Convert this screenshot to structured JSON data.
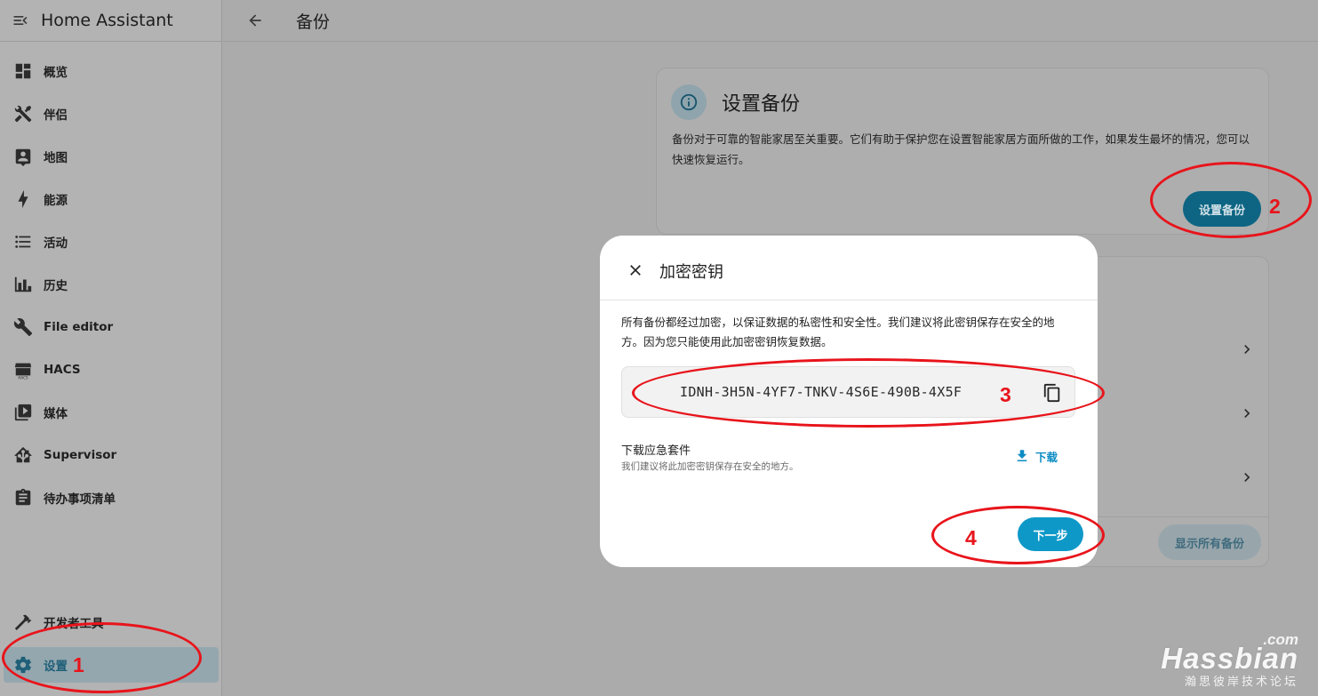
{
  "app": {
    "title": "Home Assistant"
  },
  "sidebar": {
    "items": [
      {
        "label": "概览",
        "icon": "dashboard-icon"
      },
      {
        "label": "伴侣",
        "icon": "tools-icon"
      },
      {
        "label": "地图",
        "icon": "map-account-icon"
      },
      {
        "label": "能源",
        "icon": "lightning-icon"
      },
      {
        "label": "活动",
        "icon": "list-icon"
      },
      {
        "label": "历史",
        "icon": "chart-box-icon"
      },
      {
        "label": "File editor",
        "icon": "wrench-icon"
      },
      {
        "label": "HACS",
        "icon": "hacs-icon"
      },
      {
        "label": "媒体",
        "icon": "play-box-icon"
      },
      {
        "label": "Supervisor",
        "icon": "home-assistant-icon"
      },
      {
        "label": "待办事项清单",
        "icon": "clipboard-list-icon"
      }
    ],
    "developer_tools": "开发者工具",
    "settings": "设置"
  },
  "header": {
    "title": "备份"
  },
  "setup_card": {
    "title": "设置备份",
    "description": "备份对于可靠的智能家居至关重要。它们有助于保护您在设置智能家居方面所做的工作，如果发生最坏的情况，您可以快速恢复运行。",
    "button": "设置备份"
  },
  "overview_card": {
    "show_all_button": "显示所有备份"
  },
  "dialog": {
    "title": "加密密钥",
    "description": "所有备份都经过加密，以保证数据的私密性和安全性。我们建议将此密钥保存在安全的地方。因为您只能使用此加密密钥恢复数据。",
    "encryption_key": "IDNH-3H5N-4YF7-TNKV-4S6E-490B-4X5F",
    "emergency_kit_title": "下载应急套件",
    "emergency_kit_subtitle": "我们建议将此加密密钥保存在安全的地方。",
    "download_button": "下载",
    "next_button": "下一步"
  },
  "annotations": [
    "1",
    "2",
    "3",
    "4"
  ],
  "watermark": {
    "com": ".com",
    "main": "Hassbian",
    "sub": "瀚思彼岸技术论坛"
  },
  "colors": {
    "primary": "#0e98c8",
    "annotation": "#e8141b",
    "overlay": "#ababab"
  }
}
